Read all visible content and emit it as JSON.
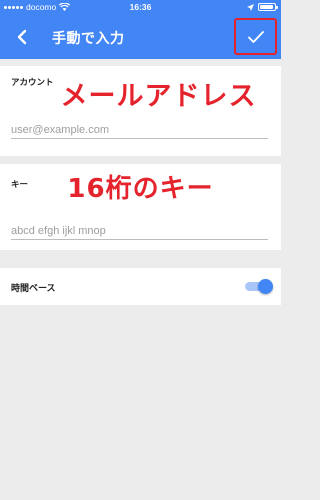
{
  "status_bar": {
    "carrier": "docomo",
    "time": "16:36",
    "battery_level": 0.95
  },
  "app_bar": {
    "title": "手動で入力",
    "back_icon": "back-arrow-icon",
    "confirm_icon": "check-icon",
    "color": "#4285f4"
  },
  "form": {
    "account": {
      "label": "アカウント",
      "placeholder": "user@example.com",
      "annotation": "メールアドレス"
    },
    "key": {
      "label": "キー",
      "placeholder": "abcd efgh ijkl mnop",
      "annotation": "16桁のキー"
    },
    "time_based": {
      "label": "時間ベース",
      "enabled": true
    }
  },
  "annotation_color": "#e5232c"
}
